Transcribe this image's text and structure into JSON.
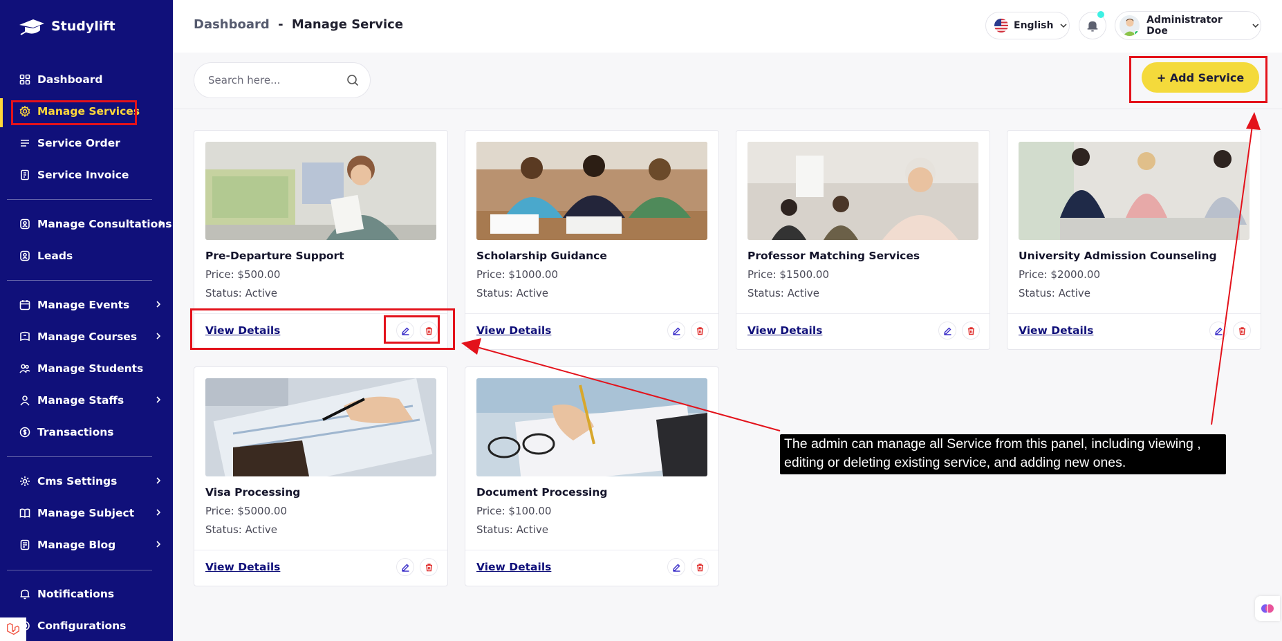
{
  "app": {
    "brand": "Studylift"
  },
  "colors": {
    "sidebar_bg": "#10107a",
    "accent": "#f4da3b",
    "highlight": "#e3121b"
  },
  "sidebar": {
    "items": [
      {
        "label": "Dashboard",
        "icon": "grid-icon",
        "active": false,
        "has_chevron": false
      },
      {
        "label": "Manage Services",
        "icon": "gear-icon",
        "active": true,
        "has_chevron": false
      },
      {
        "label": "Service Order",
        "icon": "list-icon",
        "active": false,
        "has_chevron": false
      },
      {
        "label": "Service Invoice",
        "icon": "invoice-icon",
        "active": false,
        "has_chevron": false
      },
      {
        "label": "Manage Consultations",
        "icon": "consult-icon",
        "active": false,
        "has_chevron": true
      },
      {
        "label": "Leads",
        "icon": "lead-icon",
        "active": false,
        "has_chevron": false
      },
      {
        "label": "Manage Events",
        "icon": "calendar-icon",
        "active": false,
        "has_chevron": true
      },
      {
        "label": "Manage Courses",
        "icon": "course-icon",
        "active": false,
        "has_chevron": true
      },
      {
        "label": "Manage Students",
        "icon": "students-icon",
        "active": false,
        "has_chevron": false
      },
      {
        "label": "Manage Staffs",
        "icon": "staff-icon",
        "active": false,
        "has_chevron": true
      },
      {
        "label": "Transactions",
        "icon": "transaction-icon",
        "active": false,
        "has_chevron": false
      },
      {
        "label": "Cms Settings",
        "icon": "cms-icon",
        "active": false,
        "has_chevron": true
      },
      {
        "label": "Manage Subject",
        "icon": "book-icon",
        "active": false,
        "has_chevron": true
      },
      {
        "label": "Manage Blog",
        "icon": "blog-icon",
        "active": false,
        "has_chevron": true
      },
      {
        "label": "Notifications",
        "icon": "bell-icon",
        "active": false,
        "has_chevron": false
      },
      {
        "label": "Configurations",
        "icon": "config-icon",
        "active": false,
        "has_chevron": false
      }
    ]
  },
  "header": {
    "breadcrumb_root": "Dashboard",
    "breadcrumb_sep": "-",
    "breadcrumb_current": "Manage Service",
    "language": "English",
    "user_name": "Administrator Doe"
  },
  "toolbar": {
    "search_placeholder": "Search here...",
    "add_label": "+ Add Service"
  },
  "services": [
    {
      "title": "Pre-Departure Support",
      "price": "Price: $500.00",
      "status": "Status: Active",
      "view_label": "View Details"
    },
    {
      "title": "Scholarship Guidance",
      "price": "Price: $1000.00",
      "status": "Status: Active",
      "view_label": "View Details"
    },
    {
      "title": "Professor Matching Services",
      "price": "Price: $1500.00",
      "status": "Status: Active",
      "view_label": "View Details"
    },
    {
      "title": "University Admission Counseling",
      "price": "Price: $2000.00",
      "status": "Status: Active",
      "view_label": "View Details"
    },
    {
      "title": "Visa Processing",
      "price": "Price: $5000.00",
      "status": "Status: Active",
      "view_label": "View Details"
    },
    {
      "title": "Document Processing",
      "price": "Price: $100.00",
      "status": "Status: Active",
      "view_label": "View Details"
    }
  ],
  "annotation": {
    "text": "The admin can manage all Service from this panel, including viewing , editing or deleting existing service, and adding new ones."
  }
}
